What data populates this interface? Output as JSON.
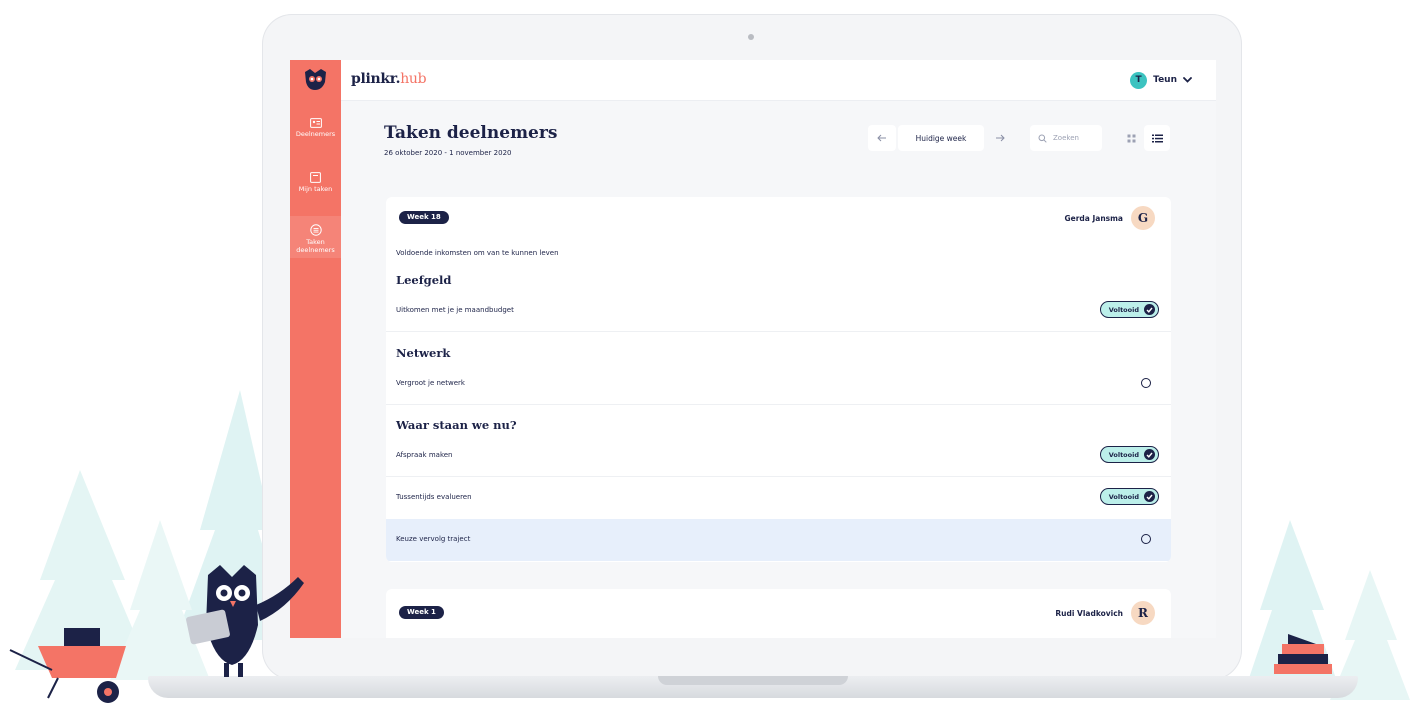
{
  "app": {
    "brand_main": "plinkr",
    "brand_dot": ".",
    "brand_suffix": "hub"
  },
  "sidebar": {
    "items": [
      {
        "label": "Deelnemers",
        "icon": "people-card-icon",
        "active": false
      },
      {
        "label": "Mijn taken",
        "icon": "task-board-icon",
        "active": false
      },
      {
        "label": "Taken deelnemers",
        "icon": "list-circle-icon",
        "active": true
      }
    ]
  },
  "header": {
    "user_initial": "T",
    "user_name": "Teun"
  },
  "page": {
    "title": "Taken deelnemers",
    "date_range": "26 oktober 2020 - 1 november 2020"
  },
  "controls": {
    "week_label": "Huidige week",
    "search_placeholder": "Zoeken"
  },
  "cards": [
    {
      "week": "Week 18",
      "person_name": "Gerda Jansma",
      "person_initial": "G",
      "goal": "Voldoende inkomsten om van te kunnen leven",
      "sections": [
        {
          "title": "Leefgeld",
          "tasks": [
            {
              "label": "Uitkomen met je je maandbudget",
              "status": "Voltooid"
            }
          ]
        },
        {
          "title": "Netwerk",
          "tasks": [
            {
              "label": "Vergroot je netwerk",
              "status": ""
            }
          ]
        },
        {
          "title": "Waar staan we nu?",
          "tasks": [
            {
              "label": "Afspraak maken",
              "status": "Voltooid"
            },
            {
              "label": "Tussentijds evalueren",
              "status": "Voltooid"
            },
            {
              "label": "Keuze vervolg traject",
              "status": ""
            }
          ]
        }
      ]
    },
    {
      "week": "Week 1",
      "person_name": "Rudi Vladkovich",
      "person_initial": "R"
    }
  ],
  "colors": {
    "sidebar": "#f47466",
    "navy": "#1c2247",
    "teal": "#3cc3c0",
    "done_badge": "#bcefea",
    "highlight_row": "#e7effb"
  }
}
